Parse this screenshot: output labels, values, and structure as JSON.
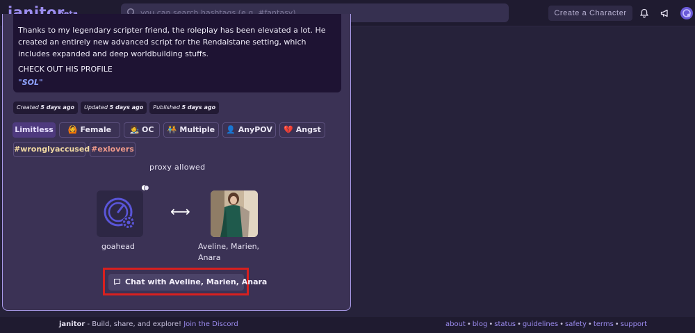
{
  "header": {
    "logo": "janitor",
    "logo_badge": "beta",
    "search_placeholder": "you can search hashtags (e.g. #fantasy)",
    "create_button": "Create a Character",
    "icons": [
      "search-icon",
      "bell-icon",
      "megaphone-icon",
      "user-avatar-icon"
    ]
  },
  "description": {
    "paragraph1": "Thanks to my legendary scripter friend, the roleplay has been elevated a lot. He created an entirely new advanced script for the Rendalstane setting, which includes expanded and deep worldbuilding stuffs.",
    "paragraph2": "CHECK OUT HIS PROFILE",
    "highlight": "\"SOL\""
  },
  "meta": {
    "created_label": "Created",
    "created_value": "5 days ago",
    "updated_label": "Updated",
    "updated_value": "5 days ago",
    "published_label": "Published",
    "published_value": "5 days ago"
  },
  "tags": [
    {
      "emoji": "",
      "label": "Limitless"
    },
    {
      "emoji": "🙆",
      "label": "Female"
    },
    {
      "emoji": "🧑‍🎨",
      "label": "OC"
    },
    {
      "emoji": "🧑‍🤝‍🧑",
      "label": "Multiple"
    },
    {
      "emoji": "👤",
      "label": "AnyPOV"
    },
    {
      "emoji": "💔",
      "label": "Angst"
    },
    {
      "emoji": "",
      "label": "#wronglyaccused"
    },
    {
      "emoji": "",
      "label": "#exlovers"
    }
  ],
  "proxy_text": "proxy allowed",
  "creator": {
    "name": "goahead"
  },
  "arrow": "⟷",
  "character": {
    "name": "Aveline, Marien, Anara"
  },
  "chat_button": "Chat with Aveline, Marien, Anara",
  "footer": {
    "brand": "janitor",
    "tagline": " - Build, share, and explore! ",
    "discord": "Join the Discord",
    "links": [
      "about",
      "blog",
      "status",
      "guidelines",
      "safety",
      "terms",
      "support"
    ]
  },
  "colors": {
    "accent": "#9c8cf0",
    "card_bg": "#3b3255",
    "highlight_border": "#d8201f"
  }
}
